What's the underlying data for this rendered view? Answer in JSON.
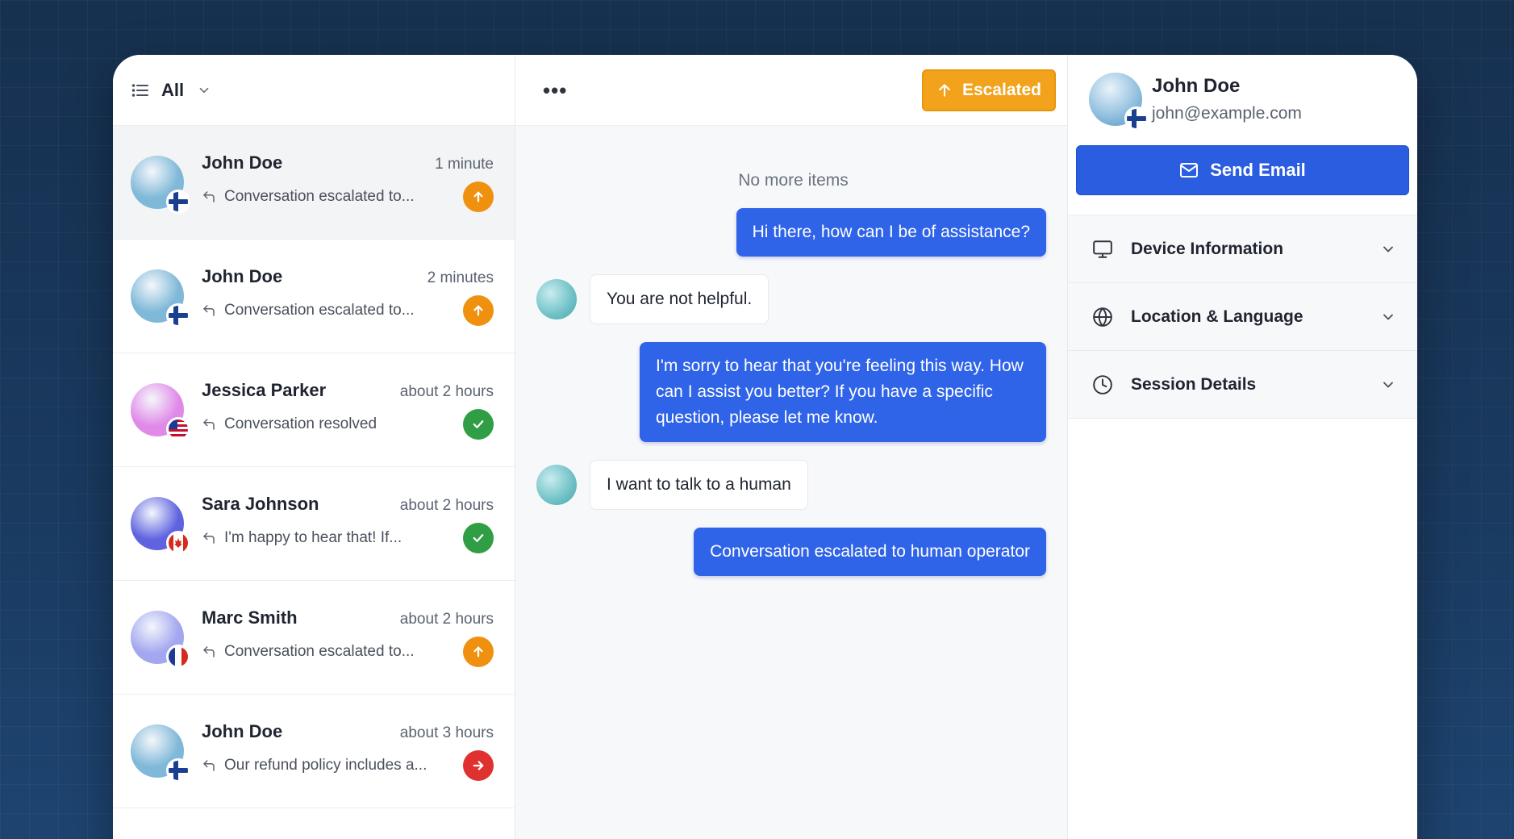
{
  "conversation_list": {
    "filter_label": "All",
    "items": [
      {
        "name": "John Doe",
        "time": "1 minute",
        "preview": "Conversation escalated to...",
        "status": "escalated",
        "avatar_color": "#7fb8d8",
        "flag": "finland",
        "active": true
      },
      {
        "name": "John Doe",
        "time": "2 minutes",
        "preview": "Conversation escalated to...",
        "status": "escalated",
        "avatar_color": "#7fb8d8",
        "flag": "finland",
        "active": false
      },
      {
        "name": "Jessica Parker",
        "time": "about 2 hours",
        "preview": "Conversation resolved",
        "status": "resolved",
        "avatar_color": "#e08ae8",
        "flag": "usa",
        "active": false
      },
      {
        "name": "Sara Johnson",
        "time": "about 2 hours",
        "preview": "I'm happy to hear that! If...",
        "status": "resolved",
        "avatar_color": "#5f63e0",
        "flag": "canada",
        "active": false
      },
      {
        "name": "Marc Smith",
        "time": "about 2 hours",
        "preview": "Conversation escalated to...",
        "status": "escalated",
        "avatar_color": "#a3a7ef",
        "flag": "france",
        "active": false
      },
      {
        "name": "John Doe",
        "time": "about 3 hours",
        "preview": "Our refund policy includes a...",
        "status": "forwarded",
        "avatar_color": "#7fb8d8",
        "flag": "finland",
        "active": false
      }
    ]
  },
  "chat": {
    "menu_label": "•••",
    "escalated_label": "Escalated",
    "no_more_items": "No more items",
    "messages": [
      {
        "from": "agent",
        "text": "Hi there, how can I be of assistance?"
      },
      {
        "from": "user",
        "text": "You are not helpful."
      },
      {
        "from": "agent",
        "text": "I'm sorry to hear that you're feeling this way. How can I assist you better? If you have a specific question, please let me know."
      },
      {
        "from": "user",
        "text": "I want to talk to a human"
      },
      {
        "from": "agent",
        "text": "Conversation escalated to human operator"
      }
    ]
  },
  "profile": {
    "name": "John Doe",
    "email": "john@example.com",
    "send_email_label": "Send Email",
    "sections": [
      {
        "label": "Device Information",
        "icon": "monitor-icon"
      },
      {
        "label": "Location & Language",
        "icon": "globe-icon"
      },
      {
        "label": "Session Details",
        "icon": "clock-icon"
      }
    ]
  },
  "colors": {
    "accent_blue": "#2a5de0",
    "escalated_orange": "#f2a31b",
    "resolved_green": "#2f9e44",
    "forward_red": "#e03131"
  }
}
